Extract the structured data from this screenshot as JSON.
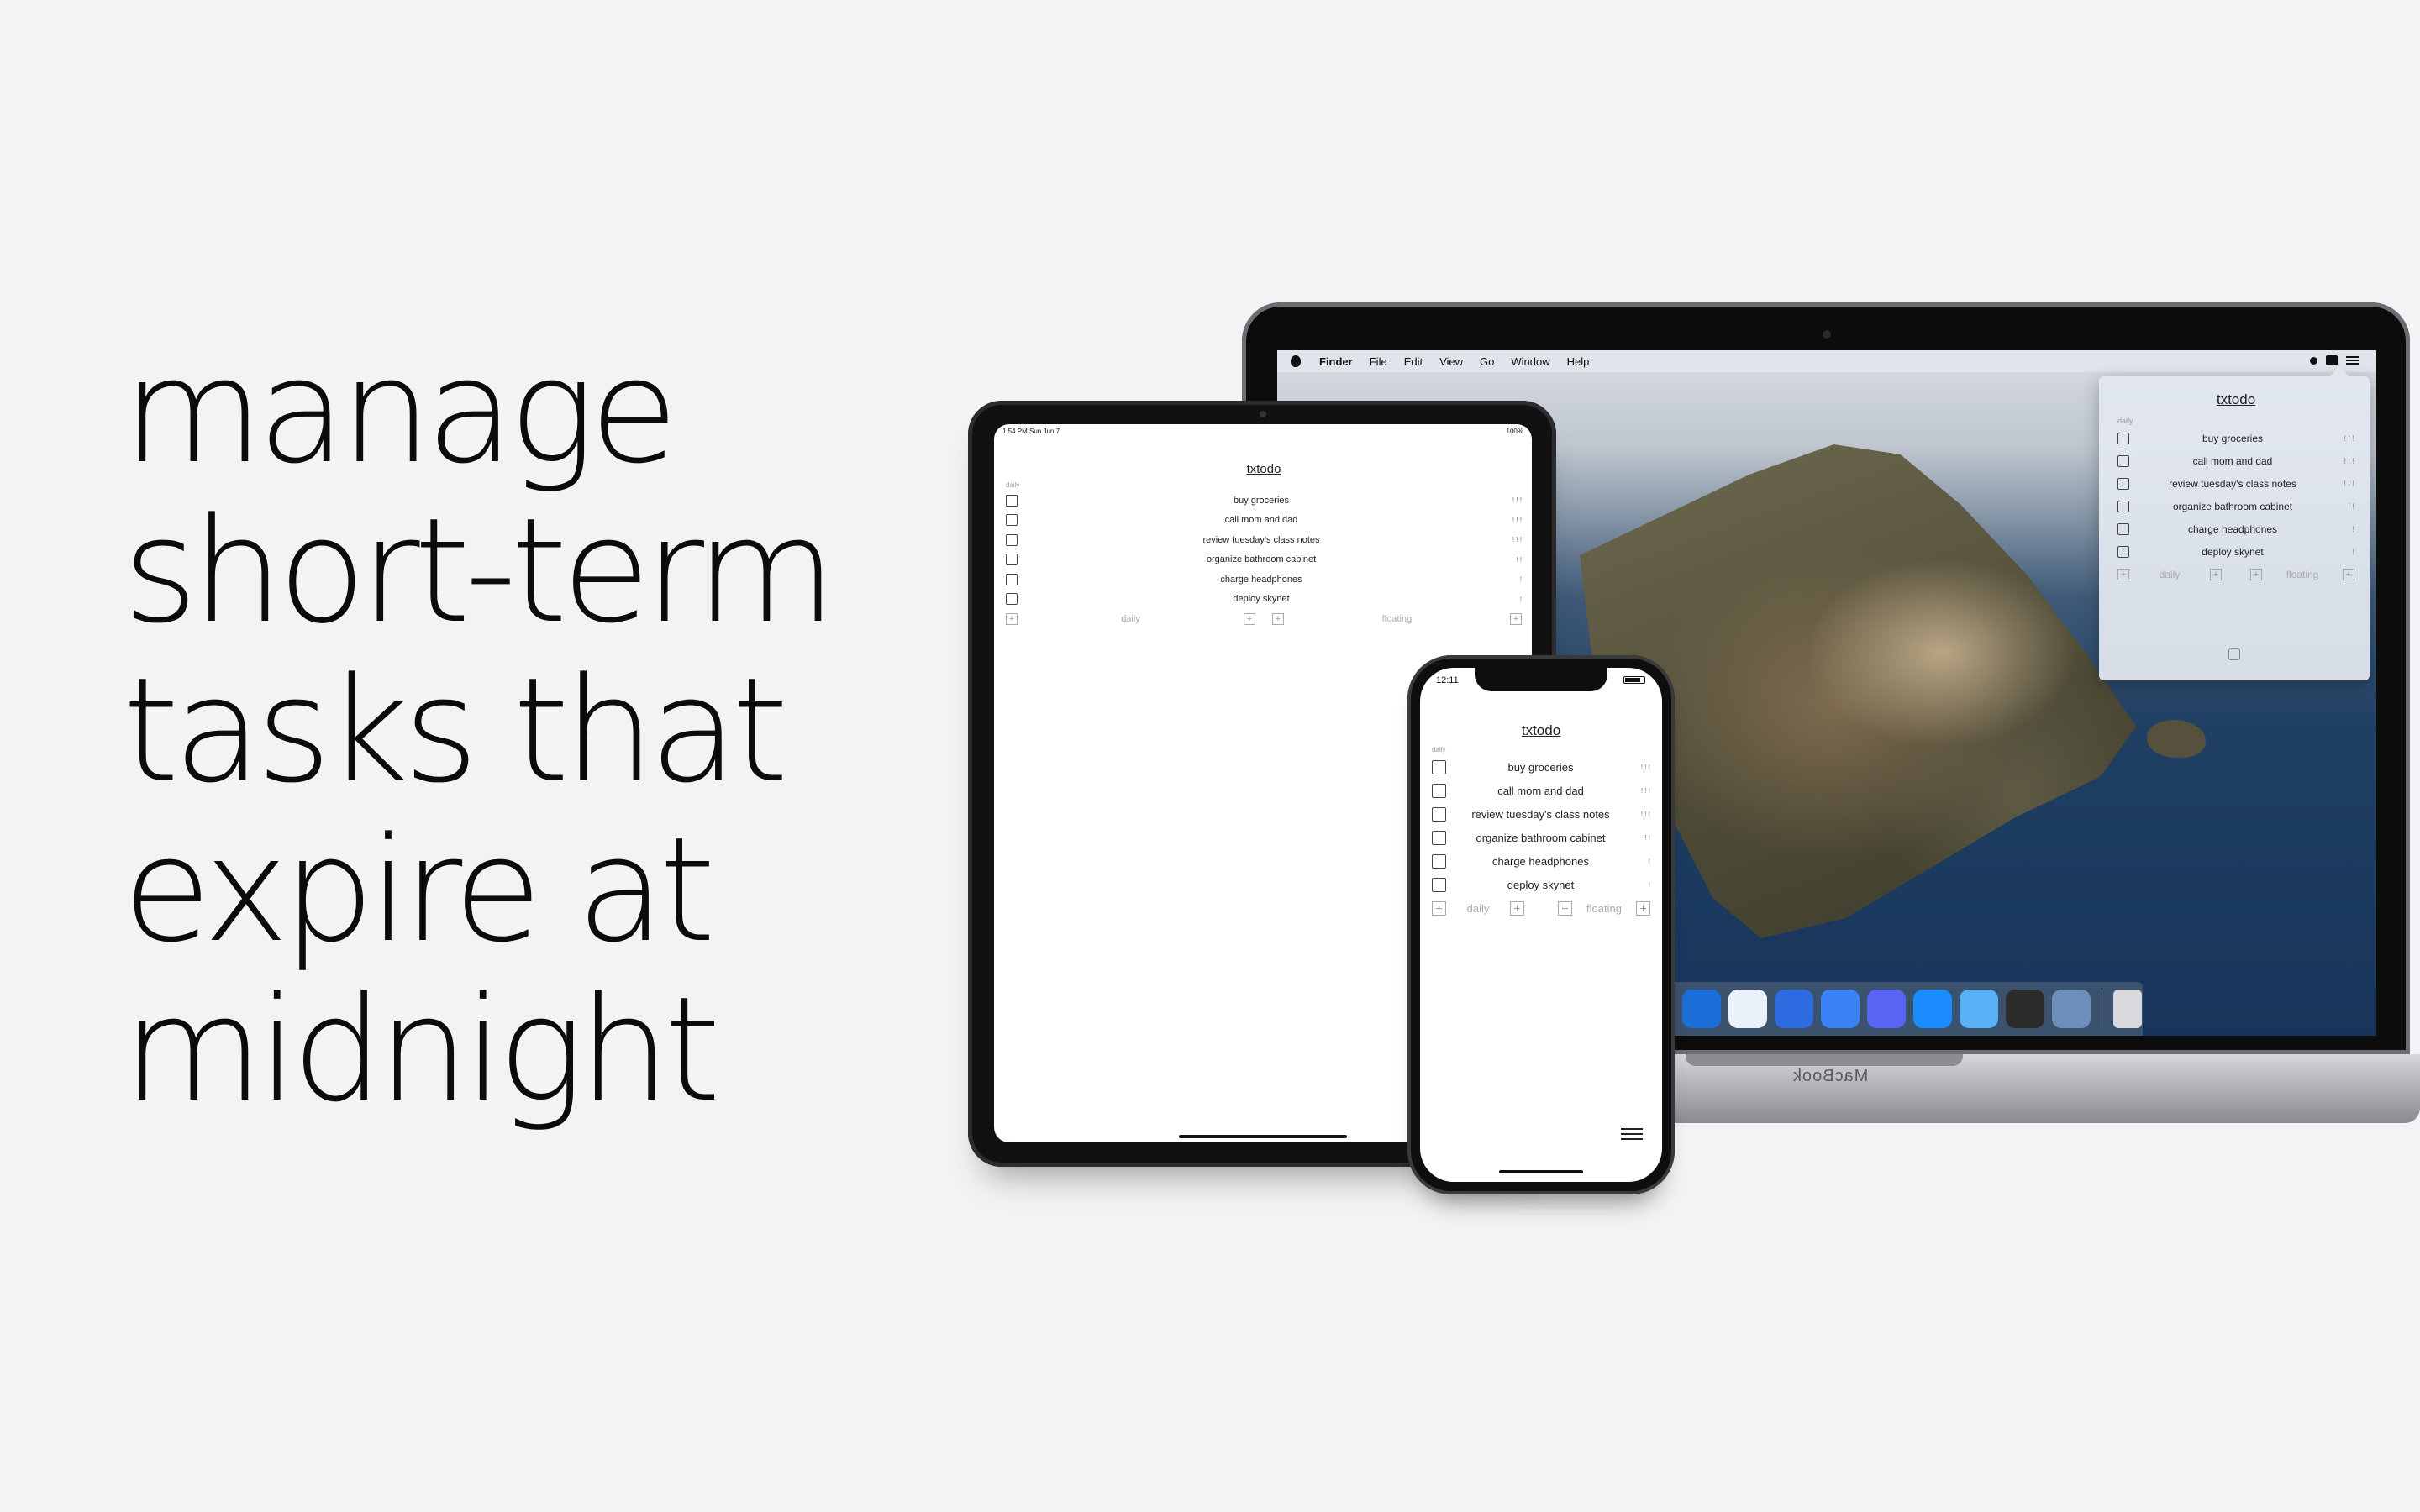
{
  "headline": {
    "lines": [
      "manage",
      "short-term",
      "tasks that",
      "expire at",
      "midnight"
    ]
  },
  "mac": {
    "menu": [
      "Finder",
      "File",
      "Edit",
      "View",
      "Go",
      "Window",
      "Help"
    ],
    "brand": "MacBook",
    "dock_apps": [
      "#1c6fd9",
      "#eaf1fb",
      "#2d6be0",
      "#3b82f6",
      "#5865f2",
      "#1a8cff",
      "#5ab0f5",
      "#2b2b2b",
      "#6b8fb8",
      "#d7d9dc"
    ]
  },
  "ipad": {
    "time": "1:54 PM  Sun Jun 7",
    "status": "100%"
  },
  "iphone": {
    "time": "12:11"
  },
  "todo": {
    "title": "txtodo",
    "section_daily": "daily",
    "footer_daily": "daily",
    "footer_floating": "floating",
    "tasks": [
      {
        "label": "buy groceries",
        "priority": "! ! !"
      },
      {
        "label": "call mom and dad",
        "priority": "! ! !"
      },
      {
        "label": "review tuesday's class notes",
        "priority": "! ! !"
      },
      {
        "label": "organize bathroom cabinet",
        "priority": "! !"
      },
      {
        "label": "charge headphones",
        "priority": "!"
      },
      {
        "label": "deploy skynet",
        "priority": "!"
      }
    ]
  },
  "colors": {
    "background": "#f3f3f6",
    "headline": "#0b0b0c"
  }
}
